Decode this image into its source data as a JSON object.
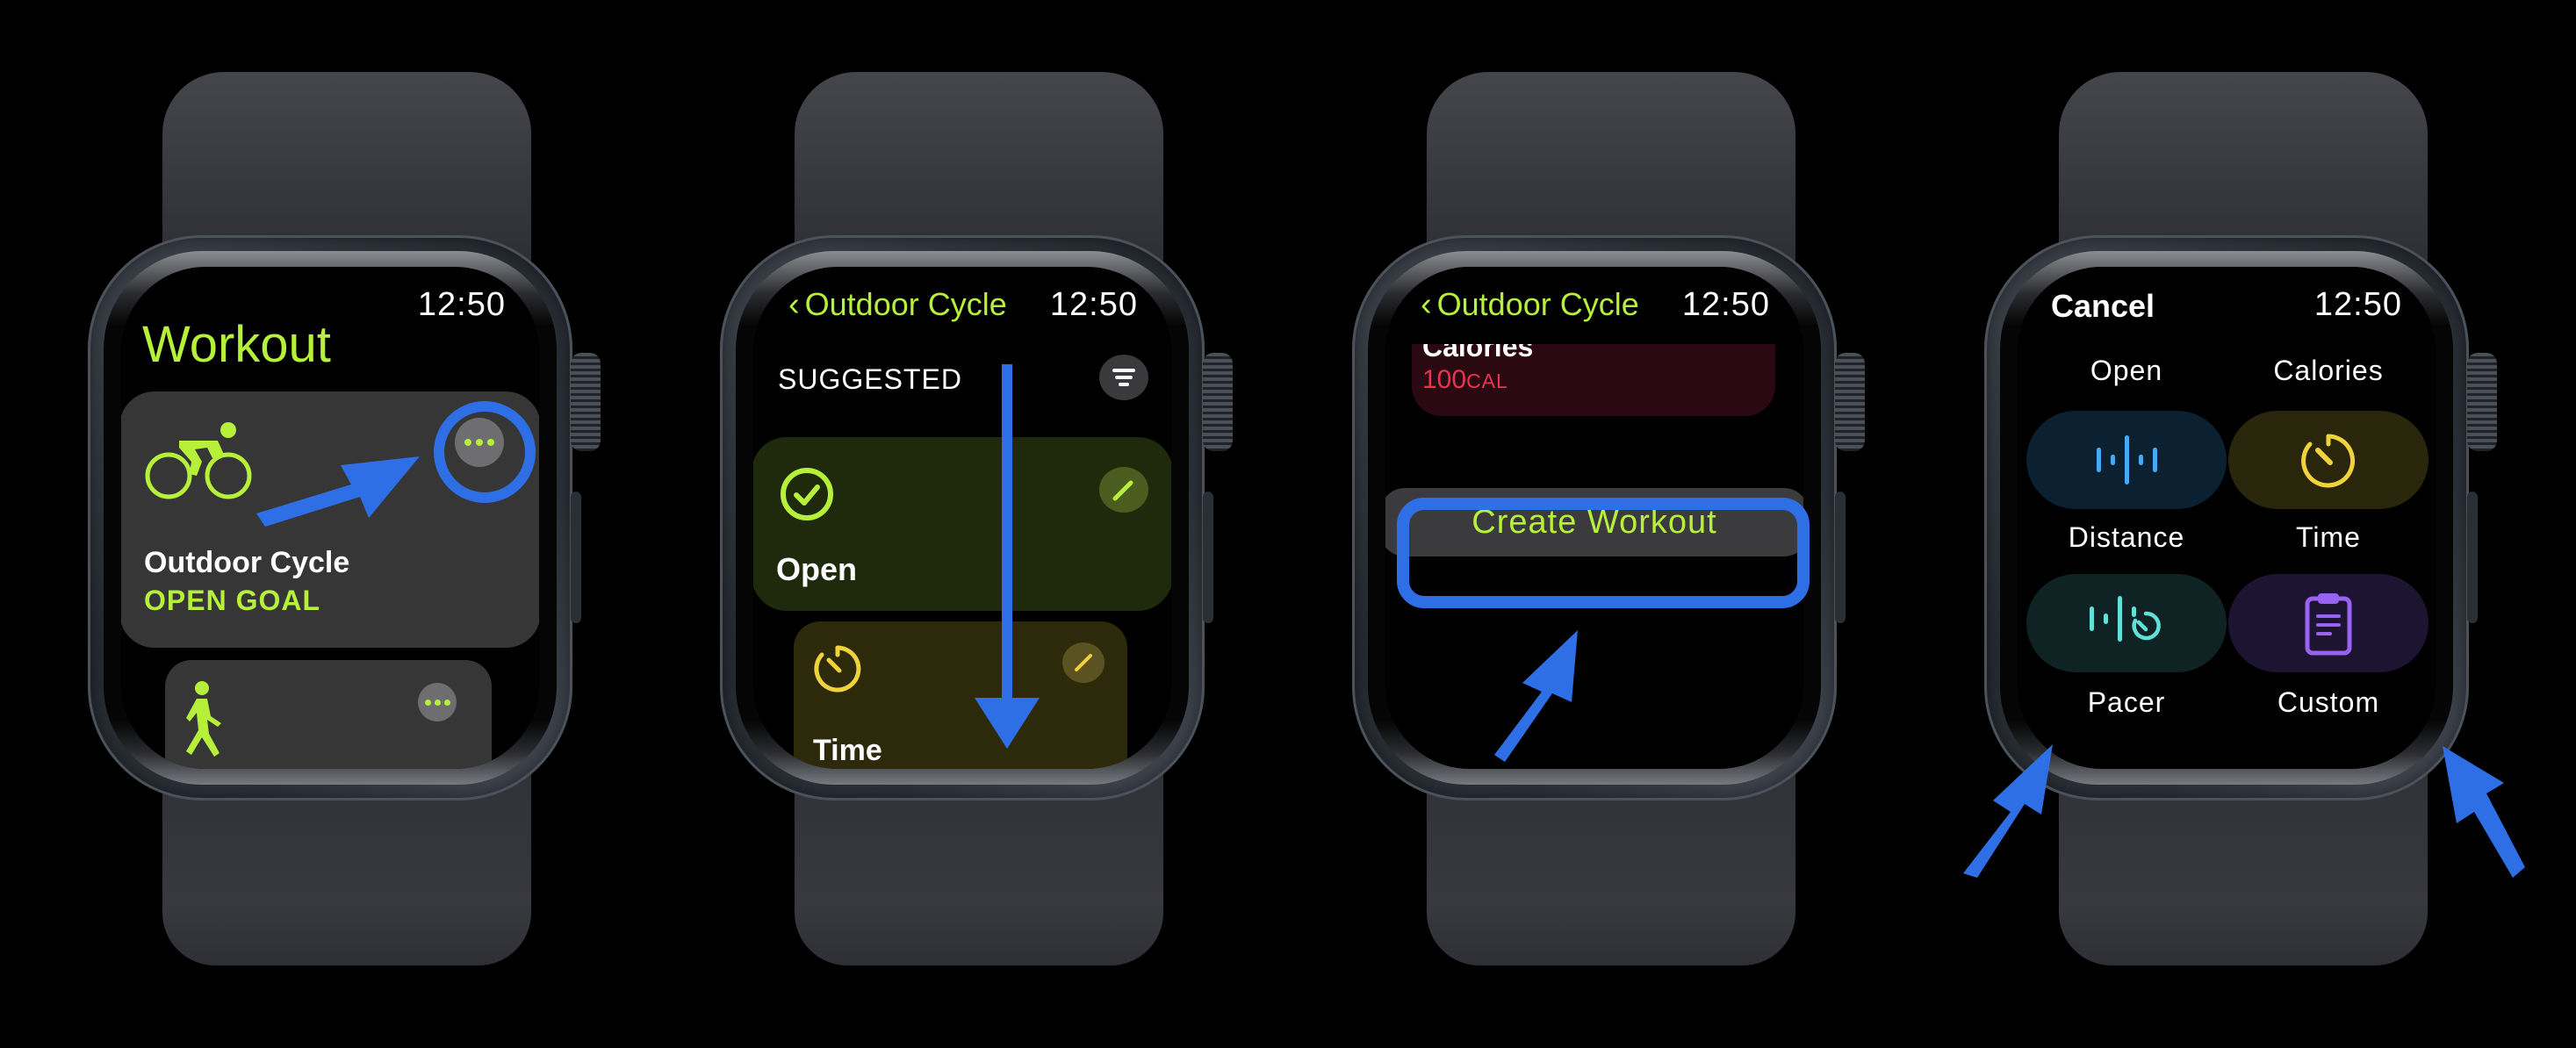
{
  "status_time": "12:50",
  "colors": {
    "accent_green": "#b6f03a",
    "annotation_blue": "#2f6fe6",
    "calories_red": "#e8344e",
    "time_yellow": "#f0d33a",
    "distance_blue": "#4aa8f0",
    "pacer_teal": "#5fe0d8",
    "custom_purple": "#9a62f0"
  },
  "watch1": {
    "title": "Workout",
    "card_primary": {
      "name": "Outdoor Cycle",
      "goal": "OPEN GOAL",
      "icon": "cycling-icon",
      "more_icon": "ellipsis-icon"
    },
    "card_secondary": {
      "icon": "walking-icon",
      "more_icon": "ellipsis-icon"
    }
  },
  "watch2": {
    "back_label": "Outdoor Cycle",
    "section_header": "SUGGESTED",
    "filter_icon": "filter-icon",
    "cards": [
      {
        "label": "Open",
        "icon": "checkmark-circle-icon",
        "edit_icon": "pencil-icon"
      },
      {
        "label": "Time",
        "icon": "timer-icon",
        "edit_icon": "pencil-icon"
      }
    ]
  },
  "watch3": {
    "back_label": "Outdoor Cycle",
    "card": {
      "label": "Calories",
      "value": "100",
      "unit": "CAL",
      "icon": "flame-icon"
    },
    "create_button": "Create Workout"
  },
  "watch4": {
    "cancel_label": "Cancel",
    "goal_types": [
      {
        "label": "Open",
        "icon": "checkmark-circle-icon"
      },
      {
        "label": "Calories",
        "icon": "flame-icon"
      },
      {
        "label": "Distance",
        "icon": "distance-icon"
      },
      {
        "label": "Time",
        "icon": "timer-icon"
      },
      {
        "label": "Pacer",
        "icon": "pacer-icon"
      },
      {
        "label": "Custom",
        "icon": "clipboard-icon"
      }
    ]
  }
}
